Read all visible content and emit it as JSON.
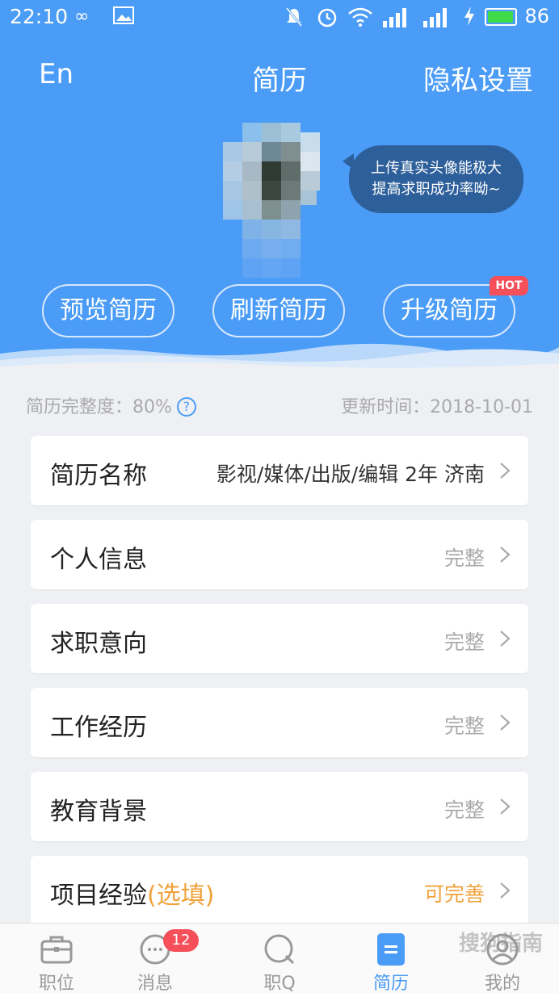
{
  "status_bar": {
    "time": "22:10",
    "battery": "86",
    "icons": [
      "infinity-icon",
      "image-icon",
      "mute-icon",
      "alarm-icon",
      "wifi-icon",
      "signal-icon",
      "signal-icon",
      "charging-icon",
      "battery-icon"
    ]
  },
  "nav": {
    "lang": "En",
    "title": "简历",
    "privacy": "隐私设置"
  },
  "profile": {
    "bubble_line1": "上传真实头像能极大",
    "bubble_line2": "提高求职成功率呦~"
  },
  "actions": {
    "preview": "预览简历",
    "refresh": "刷新简历",
    "upgrade": "升级简历",
    "hot_badge": "HOT"
  },
  "meta": {
    "completeness": "简历完整度：80%",
    "help": "?",
    "update_time": "更新时间：2018-10-01"
  },
  "sections": [
    {
      "label": "简历名称",
      "value": "影视/媒体/出版/编辑 2年 济南"
    },
    {
      "label": "个人信息",
      "value": "完整"
    },
    {
      "label": "求职意向",
      "value": "完整"
    },
    {
      "label": "工作经历",
      "value": "完整"
    },
    {
      "label": "教育背景",
      "value": "完整"
    },
    {
      "label": "项目经验",
      "optional": "(选填)",
      "value": "可完善"
    }
  ],
  "tabs": [
    {
      "label": "职位",
      "icon": "briefcase-icon"
    },
    {
      "label": "消息",
      "icon": "chat-icon",
      "badge": "12"
    },
    {
      "label": "职Q",
      "icon": "q-icon"
    },
    {
      "label": "简历",
      "icon": "resume-icon",
      "active": true
    },
    {
      "label": "我的",
      "icon": "profile-icon"
    }
  ],
  "colors": {
    "primary": "#4a9cf6",
    "accent_orange": "#f0a23a",
    "badge_red": "#f5505a",
    "bubble": "#2d5f9a"
  },
  "watermark": "搜狗指南"
}
